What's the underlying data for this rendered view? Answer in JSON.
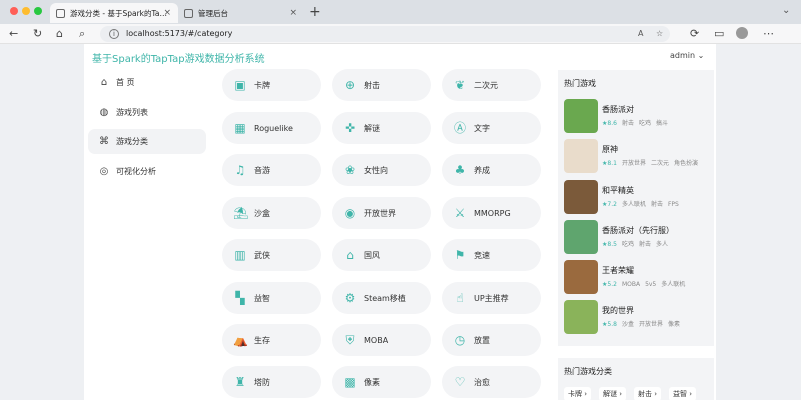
{
  "browser": {
    "tabs": [
      {
        "title": "游戏分类 - 基于Spark的TapTap游戏数据分析系统"
      },
      {
        "title": "管理后台"
      }
    ],
    "url": "localhost:5173/#/category"
  },
  "header": {
    "site_title": "基于Spark的TapTap游戏数据分析系统",
    "user": "admin"
  },
  "sidebar": {
    "items": [
      {
        "label": "首 页",
        "icon": "home-icon"
      },
      {
        "label": "游戏列表",
        "icon": "planet-icon"
      },
      {
        "label": "游戏分类",
        "icon": "gamepad-icon"
      },
      {
        "label": "可视化分析",
        "icon": "chart-icon"
      }
    ]
  },
  "categories": [
    {
      "label": "卡牌",
      "icon": "cards-icon"
    },
    {
      "label": "射击",
      "icon": "crosshair-icon"
    },
    {
      "label": "二次元",
      "icon": "anime-icon"
    },
    {
      "label": "Roguelike",
      "icon": "dungeon-icon"
    },
    {
      "label": "解谜",
      "icon": "puzzle-icon"
    },
    {
      "label": "文字",
      "icon": "text-icon"
    },
    {
      "label": "音游",
      "icon": "music-icon"
    },
    {
      "label": "女性向",
      "icon": "butterfly-icon"
    },
    {
      "label": "养成",
      "icon": "sprout-icon"
    },
    {
      "label": "沙盒",
      "icon": "sandbox-icon"
    },
    {
      "label": "开放世界",
      "icon": "globe-icon"
    },
    {
      "label": "MMORPG",
      "icon": "swords-icon"
    },
    {
      "label": "武侠",
      "icon": "scroll-icon"
    },
    {
      "label": "国风",
      "icon": "pavilion-icon"
    },
    {
      "label": "竞速",
      "icon": "flag-icon"
    },
    {
      "label": "益智",
      "icon": "blocks-icon"
    },
    {
      "label": "Steam移植",
      "icon": "steam-icon"
    },
    {
      "label": "UP主推荐",
      "icon": "thumbs-up-icon"
    },
    {
      "label": "生存",
      "icon": "survival-icon"
    },
    {
      "label": "MOBA",
      "icon": "moba-icon"
    },
    {
      "label": "放置",
      "icon": "idle-icon"
    },
    {
      "label": "塔防",
      "icon": "tower-icon"
    },
    {
      "label": "像素",
      "icon": "pixel-icon"
    },
    {
      "label": "治愈",
      "icon": "heart-icon"
    }
  ],
  "hot_games": {
    "title": "热门游戏",
    "games": [
      {
        "name": "香肠派对",
        "score": "8.6",
        "tags": [
          "射击",
          "吃鸡",
          "搞斗"
        ],
        "color": "#6aa84f"
      },
      {
        "name": "原神",
        "score": "8.1",
        "tags": [
          "开放世界",
          "二次元",
          "角色扮演"
        ],
        "color": "#e9dccb"
      },
      {
        "name": "和平精英",
        "score": "7.2",
        "tags": [
          "多人联机",
          "射击",
          "FPS"
        ],
        "color": "#7b5a3a"
      },
      {
        "name": "香肠派对（先行服）",
        "score": "8.5",
        "tags": [
          "吃鸡",
          "射击",
          "多人"
        ],
        "color": "#5fa56e"
      },
      {
        "name": "王者荣耀",
        "score": "5.2",
        "tags": [
          "MOBA",
          "5v5",
          "多人联机"
        ],
        "color": "#9a6a3e"
      },
      {
        "name": "我的世界",
        "score": "5.8",
        "tags": [
          "沙盒",
          "开放世界",
          "像素"
        ],
        "color": "#8ab35a"
      }
    ]
  },
  "hot_categories": {
    "title": "热门游戏分类",
    "chips": [
      "卡牌 ›",
      "解谜 ›",
      "射击 ›",
      "益智 ›"
    ]
  },
  "colors": {
    "accent": "#3fb5a9"
  }
}
